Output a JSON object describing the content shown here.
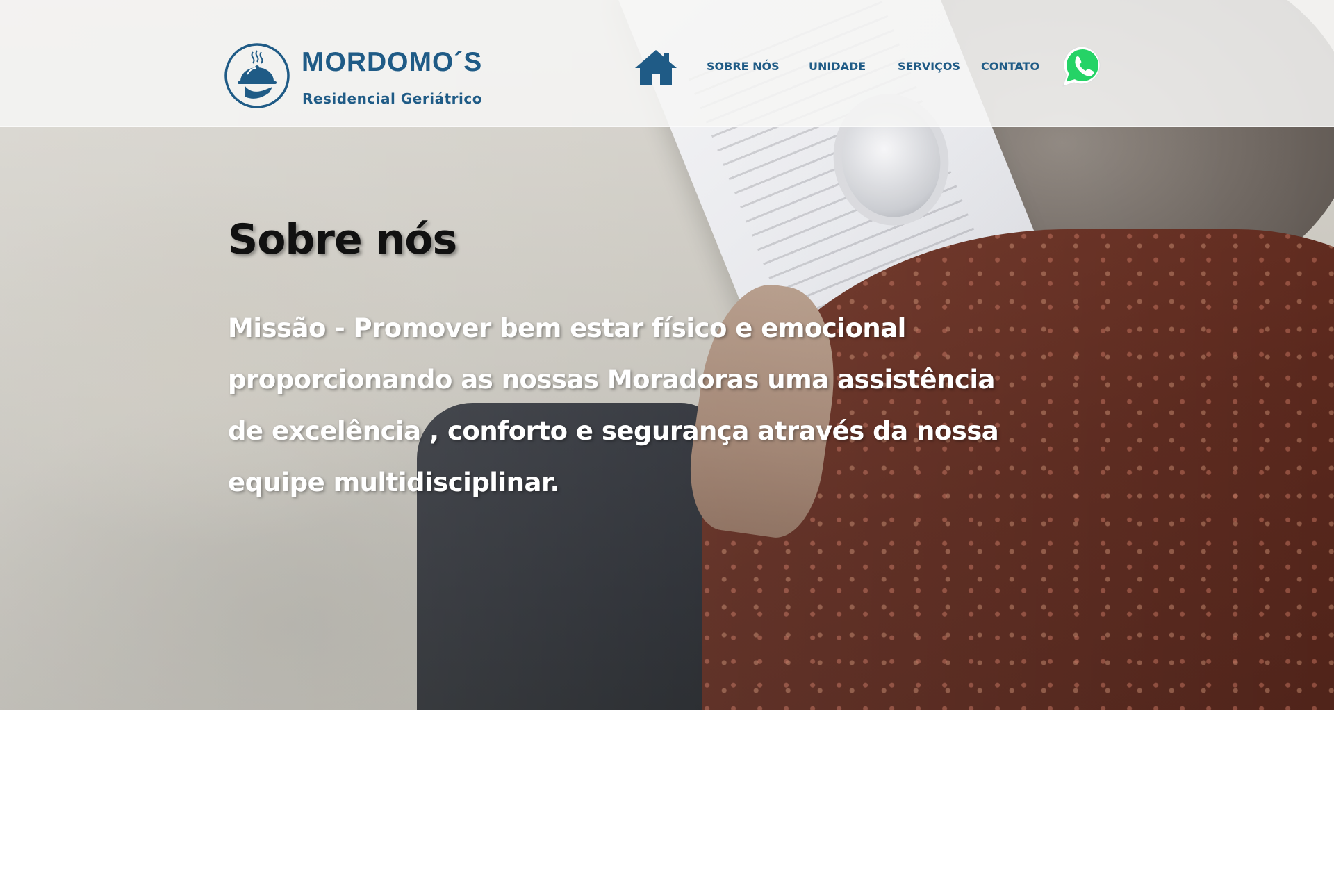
{
  "header": {
    "logo": {
      "name": "MORDOMO´S",
      "subtitle": "Residencial Geriátrico"
    },
    "nav": {
      "home_icon": "home-icon",
      "items": [
        {
          "label": "SOBRE NÓS"
        },
        {
          "label": "UNIDADE"
        },
        {
          "label": "SERVIÇOS"
        },
        {
          "label": "CONTATO"
        }
      ],
      "whatsapp_icon": "whatsapp-icon"
    }
  },
  "main": {
    "title": "Sobre nós",
    "mission": "Missão - Promover bem estar físico e emocional proporcionando as nossas Moradoras uma assistência de excelência , conforto e segurança através da nossa equipe multidisciplinar."
  },
  "colors": {
    "brand_blue": "#1f5b86",
    "whatsapp_green": "#25d366",
    "header_bg": "#f6f6f4"
  }
}
